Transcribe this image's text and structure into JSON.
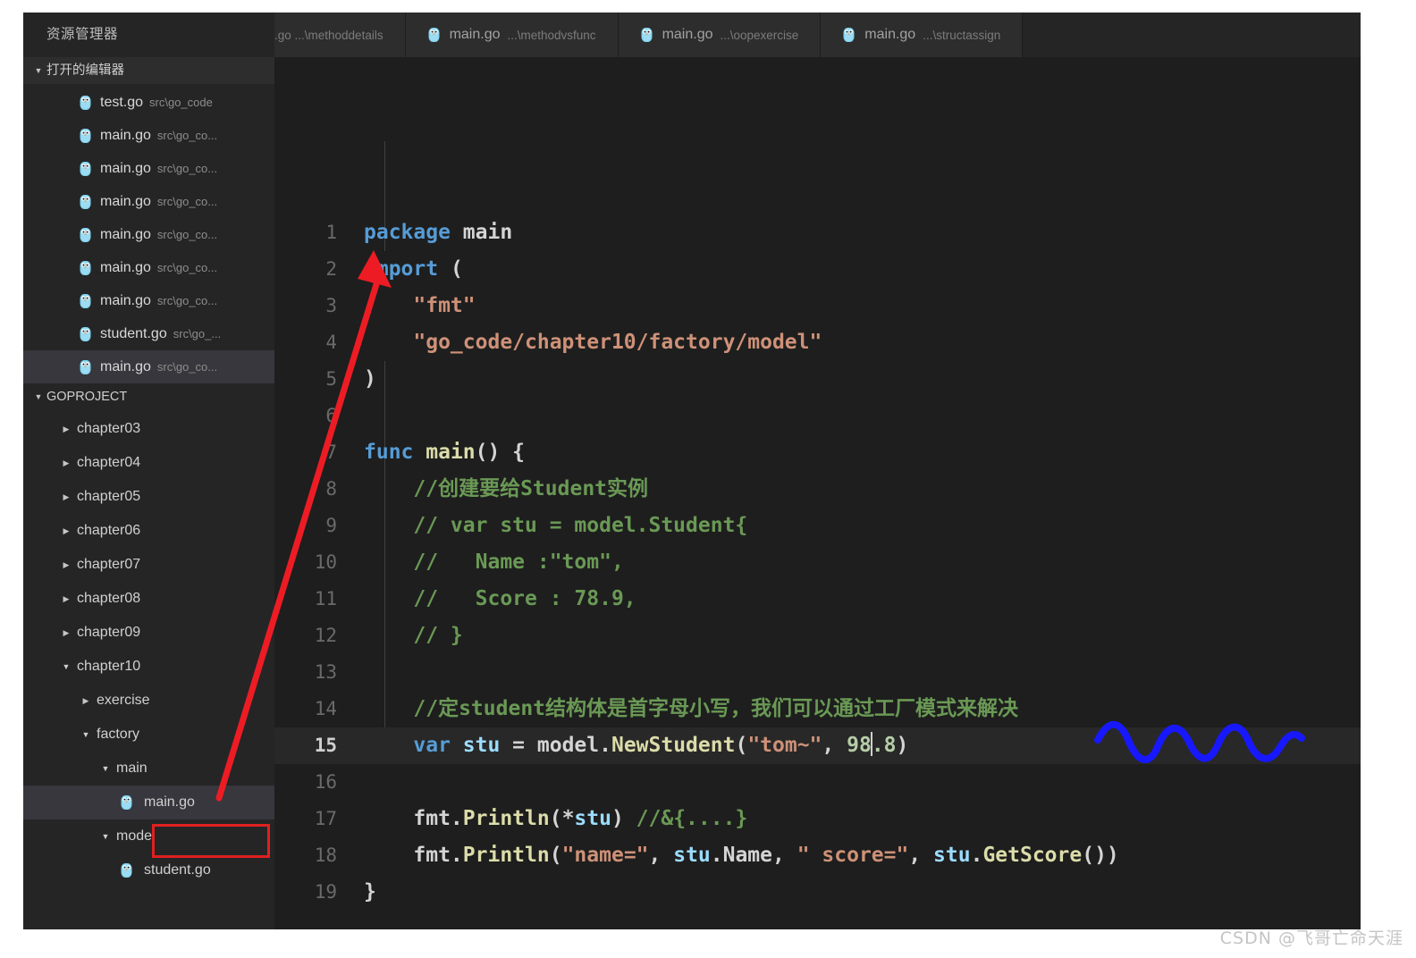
{
  "sidebar": {
    "title": "资源管理器",
    "open_editors_label": "打开的编辑器",
    "project_label": "GOPROJECT",
    "open_editors": [
      {
        "name": "test.go",
        "path": "src\\go_code",
        "icon": "go-file-icon",
        "selected": false
      },
      {
        "name": "main.go",
        "path": "src\\go_co...",
        "icon": "go-file-icon",
        "selected": false
      },
      {
        "name": "main.go",
        "path": "src\\go_co...",
        "icon": "go-file-icon",
        "selected": false
      },
      {
        "name": "main.go",
        "path": "src\\go_co...",
        "icon": "go-file-icon",
        "selected": false
      },
      {
        "name": "main.go",
        "path": "src\\go_co...",
        "icon": "go-file-icon",
        "selected": false
      },
      {
        "name": "main.go",
        "path": "src\\go_co...",
        "icon": "go-file-icon",
        "selected": false
      },
      {
        "name": "main.go",
        "path": "src\\go_co...",
        "icon": "go-file-icon",
        "selected": false
      },
      {
        "name": "student.go",
        "path": "src\\go_...",
        "icon": "go-file-icon",
        "selected": false
      },
      {
        "name": "main.go",
        "path": "src\\go_co...",
        "icon": "go-file-icon",
        "selected": true
      }
    ],
    "tree": [
      {
        "label": "chapter03",
        "type": "folder",
        "expanded": false,
        "depth": 1,
        "selected": false
      },
      {
        "label": "chapter04",
        "type": "folder",
        "expanded": false,
        "depth": 1,
        "selected": false
      },
      {
        "label": "chapter05",
        "type": "folder",
        "expanded": false,
        "depth": 1,
        "selected": false
      },
      {
        "label": "chapter06",
        "type": "folder",
        "expanded": false,
        "depth": 1,
        "selected": false
      },
      {
        "label": "chapter07",
        "type": "folder",
        "expanded": false,
        "depth": 1,
        "selected": false
      },
      {
        "label": "chapter08",
        "type": "folder",
        "expanded": false,
        "depth": 1,
        "selected": false
      },
      {
        "label": "chapter09",
        "type": "folder",
        "expanded": false,
        "depth": 1,
        "selected": false
      },
      {
        "label": "chapter10",
        "type": "folder",
        "expanded": true,
        "depth": 1,
        "selected": false
      },
      {
        "label": "exercise",
        "type": "folder",
        "expanded": false,
        "depth": 2,
        "selected": false
      },
      {
        "label": "factory",
        "type": "folder",
        "expanded": true,
        "depth": 2,
        "selected": false
      },
      {
        "label": "main",
        "type": "folder",
        "expanded": true,
        "depth": 3,
        "selected": false
      },
      {
        "label": "main.go",
        "type": "file",
        "expanded": false,
        "depth": 4,
        "selected": true
      },
      {
        "label": "model",
        "type": "folder",
        "expanded": true,
        "depth": 3,
        "selected": false
      },
      {
        "label": "student.go",
        "type": "file",
        "expanded": false,
        "depth": 4,
        "selected": false
      }
    ]
  },
  "tabs": [
    {
      "name": "",
      "path": ".go ...\\methoddetails",
      "icon": "go-file-icon",
      "clipped": true,
      "active": false
    },
    {
      "name": "main.go",
      "path": "...\\methodvsfunc",
      "icon": "go-file-icon",
      "clipped": false,
      "active": false
    },
    {
      "name": "main.go",
      "path": "...\\oopexercise",
      "icon": "go-file-icon",
      "clipped": false,
      "active": false
    },
    {
      "name": "main.go",
      "path": "...\\structassign",
      "icon": "go-file-icon",
      "clipped": false,
      "active": false
    }
  ],
  "editor": {
    "active_line": 15,
    "lines": [
      {
        "n": "1",
        "tokens": [
          {
            "t": "package ",
            "c": "kw"
          },
          {
            "t": "main",
            "c": "pl"
          }
        ]
      },
      {
        "n": "2",
        "tokens": [
          {
            "t": "import ",
            "c": "kw"
          },
          {
            "t": "(",
            "c": "pl"
          }
        ]
      },
      {
        "n": "3",
        "tokens": [
          {
            "t": "    ",
            "c": "pl"
          },
          {
            "t": "\"fmt\"",
            "c": "str"
          }
        ]
      },
      {
        "n": "4",
        "tokens": [
          {
            "t": "    ",
            "c": "pl"
          },
          {
            "t": "\"go_code/chapter10/factory/model\"",
            "c": "str"
          }
        ]
      },
      {
        "n": "5",
        "tokens": [
          {
            "t": ")",
            "c": "pl"
          }
        ]
      },
      {
        "n": "6",
        "tokens": []
      },
      {
        "n": "7",
        "tokens": [
          {
            "t": "func ",
            "c": "kw"
          },
          {
            "t": "main",
            "c": "fn"
          },
          {
            "t": "() {",
            "c": "pl"
          }
        ]
      },
      {
        "n": "8",
        "tokens": [
          {
            "t": "    //创建要给Student实例",
            "c": "cmt"
          }
        ]
      },
      {
        "n": "9",
        "tokens": [
          {
            "t": "    // var stu = model.Student{",
            "c": "cmt"
          }
        ]
      },
      {
        "n": "10",
        "tokens": [
          {
            "t": "    //   Name :\"tom\",",
            "c": "cmt"
          }
        ]
      },
      {
        "n": "11",
        "tokens": [
          {
            "t": "    //   Score : 78.9,",
            "c": "cmt"
          }
        ]
      },
      {
        "n": "12",
        "tokens": [
          {
            "t": "    // }",
            "c": "cmt"
          }
        ]
      },
      {
        "n": "13",
        "tokens": []
      },
      {
        "n": "14",
        "tokens": [
          {
            "t": "    //定student结构体是首字母小写，我们可以通过工厂模式来解决",
            "c": "cmt"
          }
        ]
      },
      {
        "n": "15",
        "tokens": [
          {
            "t": "    ",
            "c": "pl"
          },
          {
            "t": "var ",
            "c": "kw"
          },
          {
            "t": "stu",
            "c": "ident"
          },
          {
            "t": " = ",
            "c": "pl"
          },
          {
            "t": "model.",
            "c": "pl"
          },
          {
            "t": "NewStudent",
            "c": "fn"
          },
          {
            "t": "(",
            "c": "pl"
          },
          {
            "t": "\"tom~\"",
            "c": "str"
          },
          {
            "t": ", ",
            "c": "pl"
          },
          {
            "t": "98",
            "c": "num"
          },
          {
            "t": "|CURSOR|",
            "c": "cursor"
          },
          {
            "t": ".8",
            "c": "num"
          },
          {
            "t": ")",
            "c": "pl"
          }
        ]
      },
      {
        "n": "16",
        "tokens": []
      },
      {
        "n": "17",
        "tokens": [
          {
            "t": "    ",
            "c": "pl"
          },
          {
            "t": "fmt.",
            "c": "pl"
          },
          {
            "t": "Println",
            "c": "fn"
          },
          {
            "t": "(*",
            "c": "pl"
          },
          {
            "t": "stu",
            "c": "ident"
          },
          {
            "t": ") ",
            "c": "pl"
          },
          {
            "t": "//&{....}",
            "c": "cmt"
          }
        ]
      },
      {
        "n": "18",
        "tokens": [
          {
            "t": "    ",
            "c": "pl"
          },
          {
            "t": "fmt.",
            "c": "pl"
          },
          {
            "t": "Println",
            "c": "fn"
          },
          {
            "t": "(",
            "c": "pl"
          },
          {
            "t": "\"name=\"",
            "c": "str"
          },
          {
            "t": ", ",
            "c": "pl"
          },
          {
            "t": "stu",
            "c": "ident"
          },
          {
            "t": ".Name, ",
            "c": "pl"
          },
          {
            "t": "\" score=\"",
            "c": "str"
          },
          {
            "t": ", ",
            "c": "pl"
          },
          {
            "t": "stu",
            "c": "ident"
          },
          {
            "t": ".",
            "c": "pl"
          },
          {
            "t": "GetScore",
            "c": "fn"
          },
          {
            "t": "())",
            "c": "pl"
          }
        ]
      },
      {
        "n": "19",
        "tokens": [
          {
            "t": "}",
            "c": "pl"
          }
        ]
      }
    ]
  },
  "annotations": {
    "arrow_color": "#ed1c24",
    "squiggle_color": "#1818ff",
    "highlight_box_color": "#e02020",
    "arrow_name": "red-arrow-annotation",
    "squiggle_name": "blue-squiggle-annotation"
  },
  "watermark": "CSDN @飞哥亡命天涯"
}
